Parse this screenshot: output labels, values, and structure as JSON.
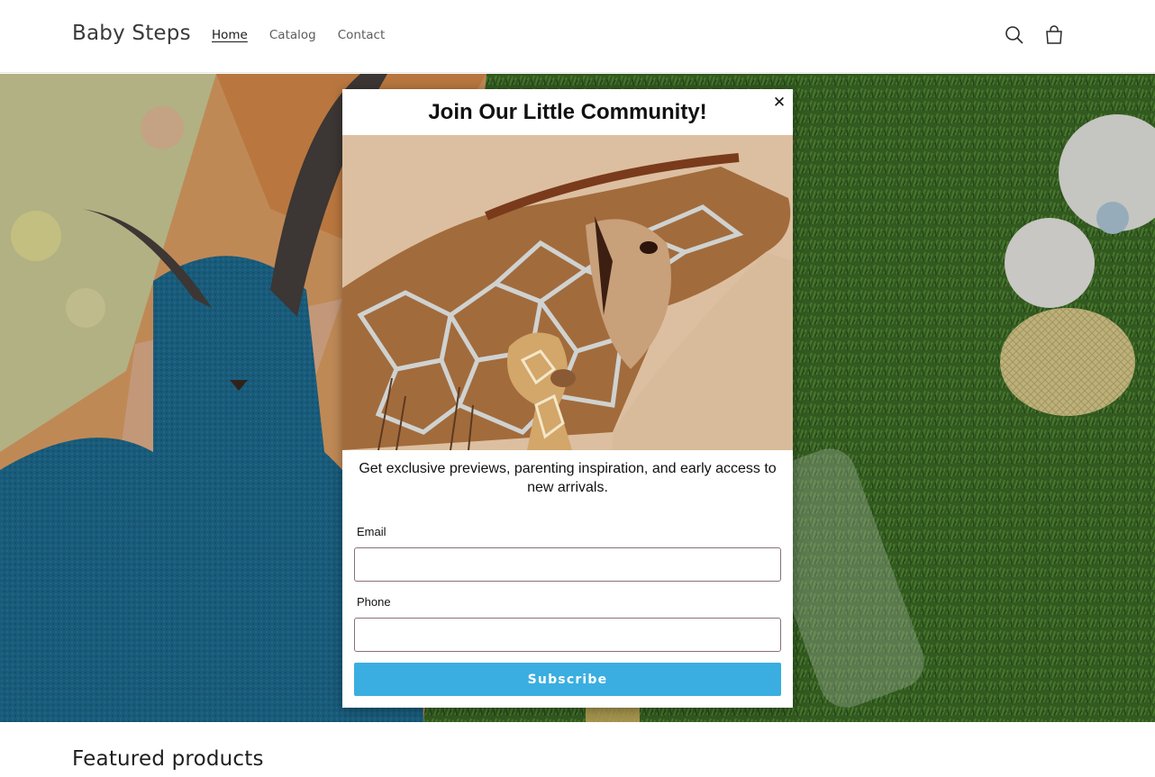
{
  "header": {
    "logo": "Baby Steps",
    "nav": [
      {
        "label": "Home",
        "active": true
      },
      {
        "label": "Catalog",
        "active": false
      },
      {
        "label": "Contact",
        "active": false
      }
    ],
    "icons": {
      "search": "search-icon",
      "cart": "cart-icon"
    }
  },
  "hero": {
    "image_description_icon": "hero-image"
  },
  "popup": {
    "title": "Join Our Little Community!",
    "close_label": "✕",
    "description": "Get exclusive previews, parenting inspiration, and early access to new arrivals.",
    "email_label": "Email",
    "email_value": "",
    "phone_label": "Phone",
    "phone_value": "",
    "subscribe_label": "Subscribe",
    "colors": {
      "button": "#3aaee0",
      "field_border": "#8a6f7a"
    }
  },
  "sections": {
    "featured_title": "Featured products"
  }
}
